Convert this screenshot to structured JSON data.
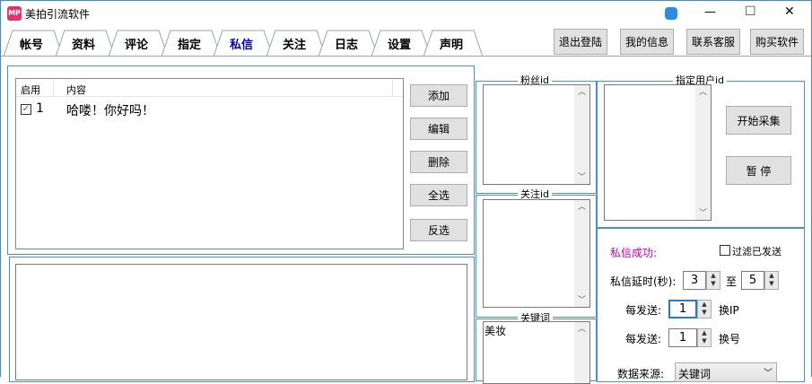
{
  "window": {
    "title": "美拍引流软件",
    "minimize": "—",
    "maximize": "☐",
    "close": "✕"
  },
  "tabs": [
    {
      "label": "帐号"
    },
    {
      "label": "资料"
    },
    {
      "label": "评论"
    },
    {
      "label": "指定"
    },
    {
      "label": "私信",
      "active": true
    },
    {
      "label": "关注"
    },
    {
      "label": "日志"
    },
    {
      "label": "设置"
    },
    {
      "label": "声明"
    }
  ],
  "top_buttons": {
    "logout": "退出登陆",
    "my_info": "我的信息",
    "contact": "联系客服",
    "buy": "购买软件"
  },
  "message_list": {
    "columns": [
      "启用",
      "内容"
    ],
    "rows": [
      {
        "enabled": true,
        "index": "1",
        "content": "哈喽！你好吗！"
      }
    ]
  },
  "list_buttons": {
    "add": "添加",
    "edit": "编辑",
    "delete": "删除",
    "select_all": "全选",
    "invert": "反选"
  },
  "groups": {
    "fans": "粉丝id",
    "follow": "关注id",
    "keyword": "关键词",
    "keyword_value": "美妆",
    "target": "指定用户id"
  },
  "actions": {
    "start": "开始采集",
    "pause": "暂 停"
  },
  "settings": {
    "success_label": "私信成功:",
    "filter_sent": "过滤已发送",
    "delay_label": "私信延时(秒):",
    "delay_min": "3",
    "to": "至",
    "delay_max": "5",
    "per_send1": "每发送:",
    "per_send1_value": "1",
    "change_ip": "换IP",
    "per_send2": "每发送:",
    "per_send2_value": "1",
    "change_account": "换号",
    "source_label": "数据来源:",
    "source_value": "关键词"
  },
  "colors": {
    "accent": "#4a90c0",
    "active_tab": "#0000c0",
    "success": "#c000c0"
  }
}
